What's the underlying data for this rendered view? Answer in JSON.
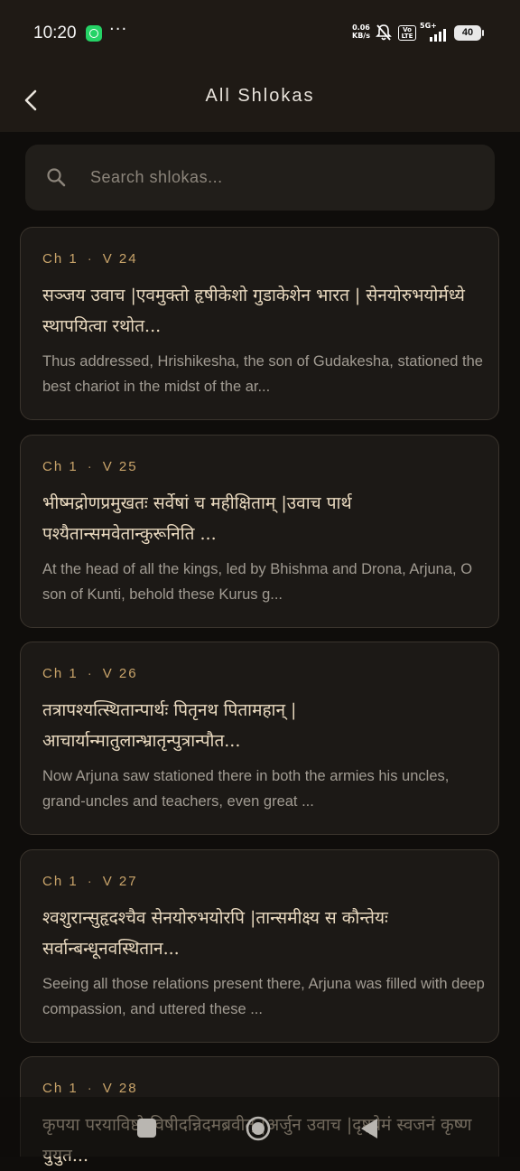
{
  "status_bar": {
    "time": "10:20",
    "more": "···",
    "net_speed_value": "0.06",
    "net_speed_unit": "KB/s",
    "volte": "Vo LTE",
    "network": "5G+",
    "battery": "40"
  },
  "app_bar": {
    "title": "All Shlokas"
  },
  "search": {
    "placeholder": "Search shlokas..."
  },
  "shlokas": [
    {
      "chapter": "Ch 1",
      "verse": "V 24",
      "sanskrit": "सञ्जय उवाच |एवमुक्तो हृषीकेशो गुडाकेशेन भारत | सेनयोरुभयोर्मध्ये स्थापयित्वा रथोत...",
      "translation": "Thus addressed, Hrishikesha, the son of Gudakesha, stationed the best chariot in the midst of the ar..."
    },
    {
      "chapter": "Ch 1",
      "verse": "V 25",
      "sanskrit": "भीष्मद्रोणप्रमुखतः सर्वेषां च महीक्षिताम् |उवाच पार्थ पश्यैतान्समवेतान्कुरूनिति ...",
      "translation": "At the head of all the kings, led by Bhishma and Drona, Arjuna, O son of Kunti, behold these Kurus g..."
    },
    {
      "chapter": "Ch 1",
      "verse": "V 26",
      "sanskrit": "तत्रापश्यत्स्थितान्पार्थः पितृनथ पितामहान् | आचार्यान्मातुलान्भ्रातृन्पुत्रान्पौत...",
      "translation": "Now Arjuna saw stationed there in both the armies his uncles, grand-uncles and teachers, even great ..."
    },
    {
      "chapter": "Ch 1",
      "verse": "V 27",
      "sanskrit": "श्वशुरान्सुहृदश्चैव सेनयोरुभयोरपि |तान्समीक्ष्य स कौन्तेयः सर्वान्बन्धूनवस्थितान...",
      "translation": "Seeing all those relations present there, Arjuna was filled with deep compassion, and uttered these ..."
    },
    {
      "chapter": "Ch 1",
      "verse": "V 28",
      "sanskrit": "कृपया परयाविष्टो विषीदन्निदमब्रवीत् |अर्जुन उवाच |दृष्ट्वेमं स्वजनं कृष्ण युयुत...",
      "translation": ""
    }
  ],
  "colors": {
    "background": "#0f0d0b",
    "bar": "#1f1a15",
    "card": "#1c1916",
    "card_border": "#3a342d",
    "accent_gold": "#c9a46a",
    "sanskrit_text": "#e9d9bf",
    "muted_text": "#a19b92"
  },
  "icons": {
    "back": "chevron-left-icon",
    "search": "search-icon",
    "nav_recents": "square-icon",
    "nav_home": "circle-icon",
    "nav_back": "triangle-back-icon"
  }
}
